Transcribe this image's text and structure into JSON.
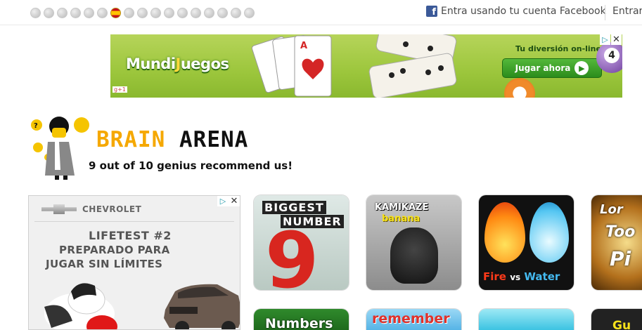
{
  "topbar": {
    "flags": [
      "flag-1",
      "flag-2",
      "flag-3",
      "flag-4",
      "flag-5",
      "flag-6",
      "flag-es",
      "flag-8",
      "flag-9",
      "flag-10",
      "flag-11",
      "flag-12",
      "flag-13",
      "flag-14",
      "flag-15",
      "flag-16",
      "flag-17"
    ],
    "active_flag": "flag-es",
    "facebook_icon": "f",
    "facebook_login": "Entra usando tu cuenta Facebook",
    "enter": "Entrar"
  },
  "top_ad": {
    "logo_part1": "Mundi",
    "logo_part2": "J",
    "logo_part3": "uegos",
    "tagline": "Tu diversión on-line",
    "button": "Jugar ahora",
    "ball_number": "4",
    "close": "✕",
    "info": "▷",
    "gplus": "g+1"
  },
  "header": {
    "brand_part1": "BRAIN",
    "brand_part2": "ARENA",
    "slogan": "9 out of 10 genius recommend us!"
  },
  "side_ad": {
    "brand": "CHEVROLET",
    "line1": "LIFETEST #2",
    "line2": "PREPARADO PARA",
    "line3": "JUGAR SIN LÍMITES",
    "close": "✕",
    "info": "▷"
  },
  "games": [
    {
      "title_line1": "BIGGEST",
      "title_line2": "NUMBER",
      "big_digit": "9"
    },
    {
      "title_line1": "KAMIKAZE",
      "title_line2": "banana"
    },
    {
      "fire": "Fire",
      "vs": "vs",
      "water": "Water"
    },
    {
      "line1": "Lor",
      "line2": "Too",
      "line3": "Pi"
    },
    {
      "title": "Numbers"
    },
    {
      "title": "remember"
    },
    {
      "title": ""
    },
    {
      "title": "Gu"
    }
  ],
  "colors": {
    "brand_orange": "#f5a800",
    "facebook_blue": "#3b5998",
    "ad_green": "#9cc63c"
  }
}
